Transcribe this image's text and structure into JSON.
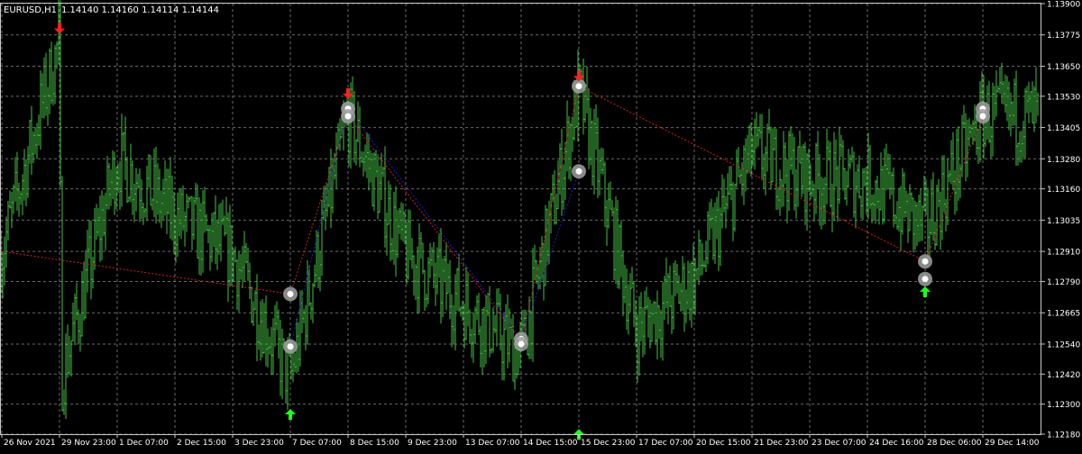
{
  "header": {
    "symbol": "EURUSD,H1",
    "ohlc": "1.14140 1.14160 1.14114 1.14144"
  },
  "colors": {
    "background": "#000000",
    "grid": "#6a6a6a",
    "frame": "#c8c8c8",
    "text": "#ffffff",
    "bars": "#44c044",
    "zigzag_red": "#d02020",
    "zigzag_blue": "#2020c8",
    "arrow_red": "#ff2020",
    "arrow_green": "#20ff20",
    "marker_ring": "#a0a0a0"
  },
  "chart_data": {
    "type": "line",
    "style": "ohlc-bars",
    "ylim": [
      1.1218,
      1.139
    ],
    "grid": true,
    "y_ticks": [
      "1.13900",
      "1.13775",
      "1.13650",
      "1.13530",
      "1.13405",
      "1.13280",
      "1.13160",
      "1.13035",
      "1.12910",
      "1.12790",
      "1.12665",
      "1.12540",
      "1.12420",
      "1.12300",
      "1.12180"
    ],
    "x_ticks": [
      "26 Nov 2021",
      "29 Nov 23:00",
      "1 Dec 07:00",
      "2 Dec 15:00",
      "3 Dec 23:00",
      "7 Dec 07:00",
      "8 Dec 15:00",
      "9 Dec 23:00",
      "13 Dec 07:00",
      "14 Dec 15:00",
      "15 Dec 23:00",
      "17 Dec 07:00",
      "20 Dec 15:00",
      "21 Dec 23:00",
      "23 Dec 07:00",
      "24 Dec 16:00",
      "28 Dec 06:00",
      "29 Dec 14:00"
    ],
    "price_keypoints": [
      {
        "x": "26 Nov 2021",
        "y": 1.1291
      },
      {
        "x": "29 Nov 23:00",
        "y": 1.1375
      },
      {
        "x": "29 Nov 23:00",
        "y": 1.124
      },
      {
        "x": "1 Dec 07:00",
        "y": 1.1328
      },
      {
        "x": "2 Dec 15:00",
        "y": 1.1305
      },
      {
        "x": "3 Dec 23:00",
        "y": 1.129
      },
      {
        "x": "7 Dec 07:00",
        "y": 1.124
      },
      {
        "x": "8 Dec 15:00",
        "y": 1.1345
      },
      {
        "x": "9 Dec 23:00",
        "y": 1.129
      },
      {
        "x": "13 Dec 07:00",
        "y": 1.127
      },
      {
        "x": "14 Dec 15:00",
        "y": 1.125
      },
      {
        "x": "15 Dec 23:00",
        "y": 1.1355
      },
      {
        "x": "17 Dec 07:00",
        "y": 1.126
      },
      {
        "x": "20 Dec 15:00",
        "y": 1.128
      },
      {
        "x": "21 Dec 23:00",
        "y": 1.133
      },
      {
        "x": "23 Dec 07:00",
        "y": 1.132
      },
      {
        "x": "24 Dec 16:00",
        "y": 1.132
      },
      {
        "x": "28 Dec 06:00",
        "y": 1.13
      },
      {
        "x": "29 Dec 14:00",
        "y": 1.1345
      }
    ],
    "zigzag_red": [
      {
        "x": "26 Nov 2021",
        "y": 1.1291
      },
      {
        "x": "7 Dec 07:00",
        "y": 1.1274
      },
      {
        "x": "8 Dec 15:00",
        "y": 1.1345
      },
      {
        "x": "14 Dec 15:00",
        "y": 1.1255
      },
      {
        "x": "15 Dec 23:00",
        "y": 1.1357
      },
      {
        "x": "28 Dec 06:00",
        "y": 1.1287
      },
      {
        "x": "29 Dec 14:00",
        "y": 1.1345
      }
    ],
    "zigzag_blue": [
      {
        "x": "7 Dec 07:00",
        "y": 1.1253
      },
      {
        "x": "8 Dec 15:00",
        "y": 1.1348
      },
      {
        "x": "14 Dec 15:00",
        "y": 1.1256
      },
      {
        "x": "15 Dec 23:00",
        "y": 1.1323
      }
    ],
    "markers": [
      {
        "x": "7 Dec 07:00",
        "y": 1.1274
      },
      {
        "x": "7 Dec 07:00",
        "y": 1.1253
      },
      {
        "x": "8 Dec 15:00",
        "y": 1.1348
      },
      {
        "x": "8 Dec 15:00",
        "y": 1.1345
      },
      {
        "x": "14 Dec 15:00",
        "y": 1.1256
      },
      {
        "x": "14 Dec 15:00",
        "y": 1.1254
      },
      {
        "x": "15 Dec 23:00",
        "y": 1.1357
      },
      {
        "x": "15 Dec 23:00",
        "y": 1.1323
      },
      {
        "x": "28 Dec 06:00",
        "y": 1.1287
      },
      {
        "x": "28 Dec 06:00",
        "y": 1.128
      },
      {
        "x": "29 Dec 14:00",
        "y": 1.1348
      },
      {
        "x": "29 Dec 14:00",
        "y": 1.1345
      }
    ],
    "arrows_down": [
      {
        "x": "29 Nov 23:00",
        "y": 1.1379
      },
      {
        "x": "8 Dec 15:00",
        "y": 1.1353
      },
      {
        "x": "15 Dec 23:00",
        "y": 1.136
      }
    ],
    "arrows_up": [
      {
        "x": "7 Dec 07:00",
        "y": 1.1227
      },
      {
        "x": "15 Dec 23:00",
        "y": 1.1219
      },
      {
        "x": "28 Dec 06:00",
        "y": 1.1276
      }
    ]
  }
}
